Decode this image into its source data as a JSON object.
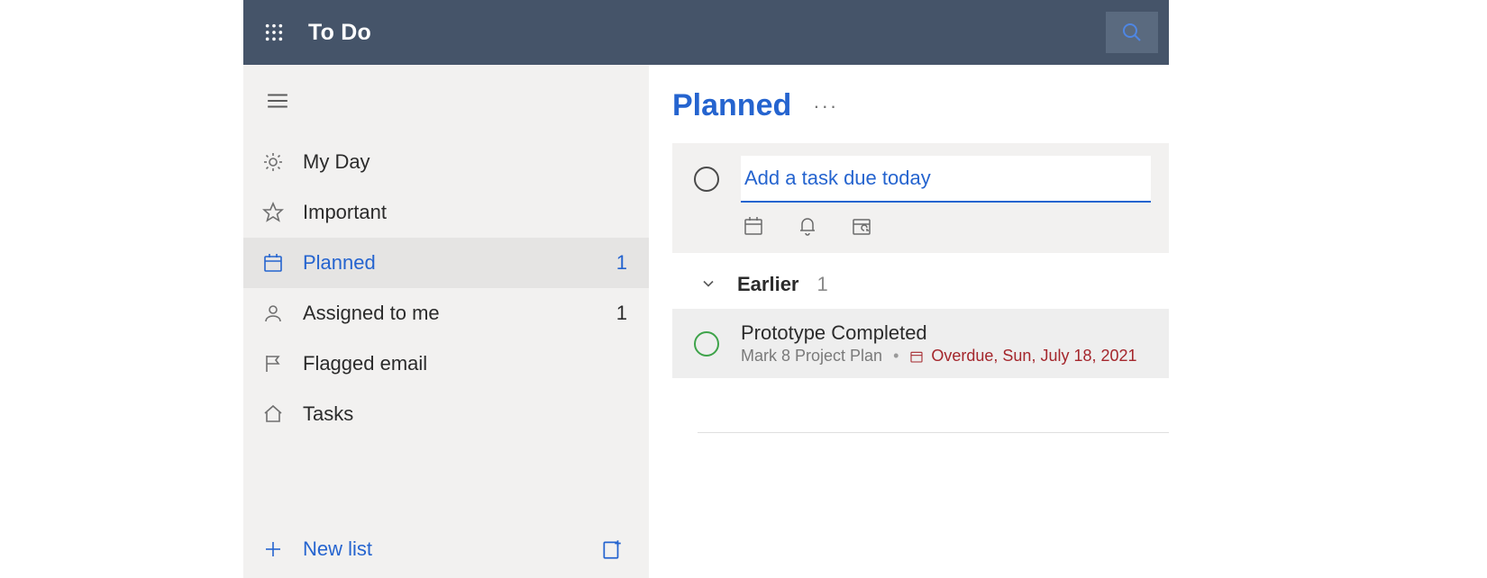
{
  "app": {
    "title": "To Do"
  },
  "sidebar": {
    "items": [
      {
        "icon": "sun-icon",
        "label": "My Day",
        "count": ""
      },
      {
        "icon": "star-icon",
        "label": "Important",
        "count": ""
      },
      {
        "icon": "calendar-icon",
        "label": "Planned",
        "count": "1",
        "active": true
      },
      {
        "icon": "person-icon",
        "label": "Assigned to me",
        "count": "1"
      },
      {
        "icon": "flag-icon",
        "label": "Flagged email",
        "count": ""
      },
      {
        "icon": "home-icon",
        "label": "Tasks",
        "count": ""
      }
    ],
    "new_list_label": "New list"
  },
  "main": {
    "title": "Planned",
    "options_label": "···",
    "add_task_placeholder": "Add a task due today",
    "sections": [
      {
        "title": "Earlier",
        "count": "1",
        "tasks": [
          {
            "title": "Prototype Completed",
            "list": "Mark 8 Project Plan",
            "due_label": "Overdue, Sun, July 18, 2021",
            "overdue": true
          }
        ]
      }
    ]
  }
}
